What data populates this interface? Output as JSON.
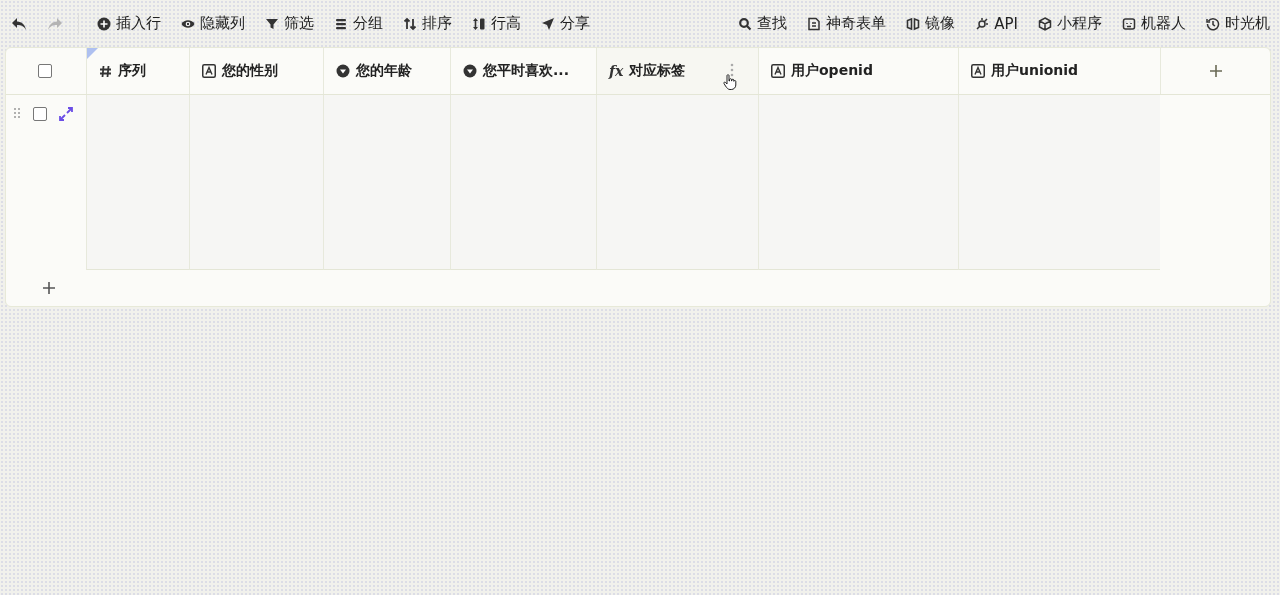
{
  "toolbar": {
    "history": [
      {
        "kind": "undo",
        "disabled": false
      },
      {
        "kind": "redo",
        "disabled": true
      }
    ],
    "left_actions": [
      {
        "kind": "plus",
        "label": "插入行"
      },
      {
        "kind": "eye",
        "label": "隐藏列"
      },
      {
        "kind": "filter",
        "label": "筛选"
      },
      {
        "kind": "group",
        "label": "分组"
      },
      {
        "kind": "sort",
        "label": "排序"
      },
      {
        "kind": "height",
        "label": "行高"
      },
      {
        "kind": "send",
        "label": "分享"
      }
    ],
    "right_actions": [
      {
        "kind": "search",
        "label": "查找"
      },
      {
        "kind": "form",
        "label": "神奇表单"
      },
      {
        "kind": "mirror",
        "label": "镜像"
      },
      {
        "kind": "api",
        "label": "API"
      },
      {
        "kind": "cube",
        "label": "小程序"
      },
      {
        "kind": "robot",
        "label": "机器人"
      },
      {
        "kind": "history",
        "label": "时光机"
      }
    ]
  },
  "table": {
    "header_checkbox": {
      "checked": false
    },
    "columns": [
      {
        "kind": "number",
        "label": "序列",
        "hovered": false
      },
      {
        "kind": "text",
        "label": "您的性别",
        "hovered": false
      },
      {
        "kind": "select",
        "label": "您的年龄",
        "hovered": false
      },
      {
        "kind": "select",
        "label": "您平时喜欢...",
        "hovered": false
      },
      {
        "kind": "formula",
        "symbol": "fx",
        "label": "对应标签",
        "hovered": true
      },
      {
        "kind": "text",
        "label": "用户openid",
        "hovered": false
      },
      {
        "kind": "text",
        "label": "用户unionid",
        "hovered": false
      }
    ],
    "rows": [
      {
        "checked": false
      }
    ]
  }
}
